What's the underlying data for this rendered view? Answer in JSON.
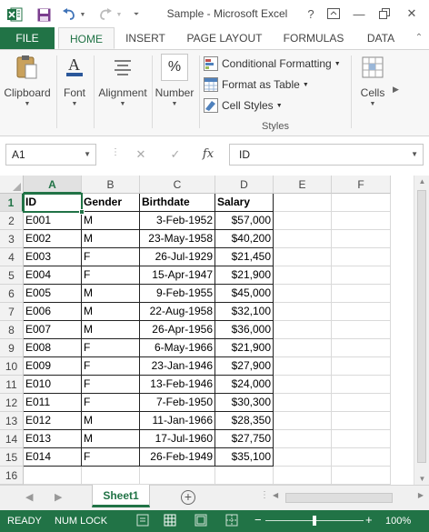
{
  "window": {
    "title": "Sample - Microsoft Excel",
    "help_label": "?",
    "minimize_label": "—",
    "close_label": "✕"
  },
  "tabs": [
    "FILE",
    "HOME",
    "INSERT",
    "PAGE LAYOUT",
    "FORMULAS",
    "DATA"
  ],
  "ribbon": {
    "clipboard": "Clipboard",
    "font": "Font",
    "alignment": "Alignment",
    "number": "Number",
    "conditional_formatting": "Conditional Formatting",
    "format_as_table": "Format as Table",
    "cell_styles": "Cell Styles",
    "styles_group": "Styles",
    "cells": "Cells"
  },
  "formula_bar": {
    "name_box": "A1",
    "formula": "ID",
    "fx_label": "fx",
    "cancel_label": "✕",
    "enter_label": "✓"
  },
  "columns": [
    "A",
    "B",
    "C",
    "D",
    "E",
    "F"
  ],
  "rows": [
    "1",
    "2",
    "3",
    "4",
    "5",
    "6",
    "7",
    "8",
    "9",
    "10",
    "11",
    "12",
    "13",
    "14",
    "15",
    "16"
  ],
  "table": {
    "header": [
      "ID",
      "Gender",
      "Birthdate",
      "Salary"
    ],
    "rows": [
      [
        "E001",
        "M",
        "3-Feb-1952",
        "$57,000"
      ],
      [
        "E002",
        "M",
        "23-May-1958",
        "$40,200"
      ],
      [
        "E003",
        "F",
        "26-Jul-1929",
        "$21,450"
      ],
      [
        "E004",
        "F",
        "15-Apr-1947",
        "$21,900"
      ],
      [
        "E005",
        "M",
        "9-Feb-1955",
        "$45,000"
      ],
      [
        "E006",
        "M",
        "22-Aug-1958",
        "$32,100"
      ],
      [
        "E007",
        "M",
        "26-Apr-1956",
        "$36,000"
      ],
      [
        "E008",
        "F",
        "6-May-1966",
        "$21,900"
      ],
      [
        "E009",
        "F",
        "23-Jan-1946",
        "$27,900"
      ],
      [
        "E010",
        "F",
        "13-Feb-1946",
        "$24,000"
      ],
      [
        "E011",
        "F",
        "7-Feb-1950",
        "$30,300"
      ],
      [
        "E012",
        "M",
        "11-Jan-1966",
        "$28,350"
      ],
      [
        "E013",
        "M",
        "17-Jul-1960",
        "$27,750"
      ],
      [
        "E014",
        "F",
        "26-Feb-1949",
        "$35,100"
      ]
    ]
  },
  "sheet": {
    "tab_label": "Sheet1",
    "add_label": "+"
  },
  "status": {
    "ready": "READY",
    "numlock": "NUM LOCK",
    "zoom_minus": "−",
    "zoom_plus": "+",
    "zoom": "100%",
    "zoom_fraction": 0.5
  },
  "colors": {
    "accent": "#217346"
  }
}
